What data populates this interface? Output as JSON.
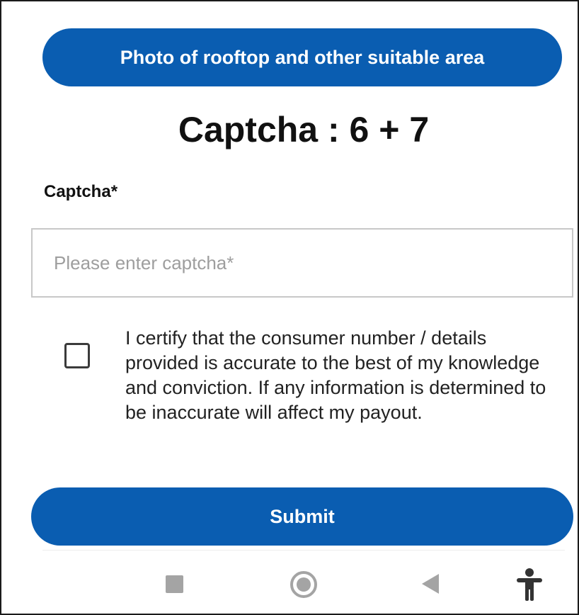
{
  "top_button": {
    "label": "Photo of rooftop and other suitable area"
  },
  "captcha": {
    "title": "Captcha : 6 + 7",
    "field_label": "Captcha*",
    "input_value": "",
    "input_placeholder": "Please enter captcha*"
  },
  "certification": {
    "checked": false,
    "text": "I certify that the consumer number / details provided is accurate to the best of my knowledge and conviction. If any information is determined to be inaccurate will affect my payout."
  },
  "submit": {
    "label": "Submit"
  },
  "navigation_bar": {
    "icons": [
      "recent-apps-icon",
      "home-icon",
      "back-icon",
      "accessibility-icon"
    ]
  },
  "colors": {
    "primary_button": "#0a5db1",
    "button_text": "#ffffff",
    "nav_icon": "#a4a4a4",
    "input_border": "#c8c8c8",
    "placeholder_text": "#9e9e9e"
  }
}
